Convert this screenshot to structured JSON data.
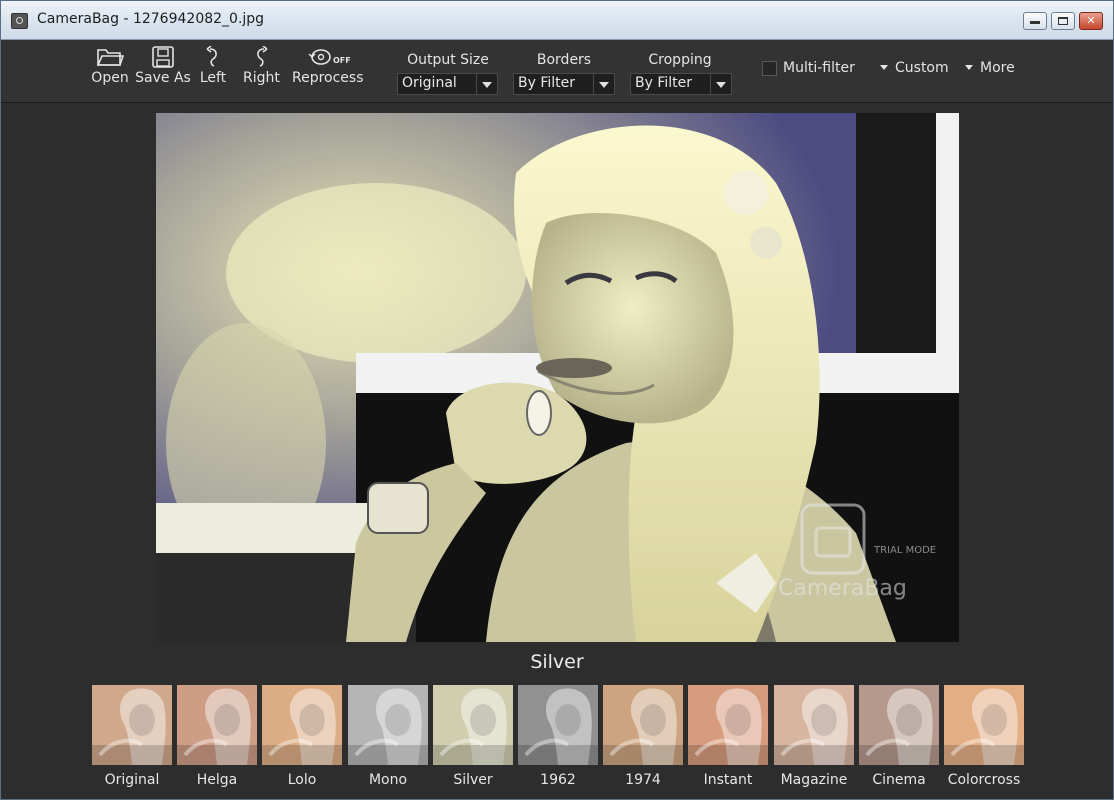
{
  "window": {
    "title": "CameraBag - 1276942082_0.jpg"
  },
  "toolbar": {
    "buttons": [
      {
        "label": "Open",
        "icon": "folder-icon"
      },
      {
        "label": "Save As",
        "icon": "save-icon"
      },
      {
        "label": "Left",
        "icon": "rotate-left-icon"
      },
      {
        "label": "Right",
        "icon": "rotate-right-icon"
      },
      {
        "label": "Reprocess",
        "icon": "reprocess-icon",
        "toggle": "OFF"
      }
    ],
    "output_size": {
      "label": "Output Size",
      "value": "Original"
    },
    "borders": {
      "label": "Borders",
      "value": "By Filter"
    },
    "cropping": {
      "label": "Cropping",
      "value": "By Filter"
    },
    "multi_filter": {
      "label": "Multi-filter",
      "checked": false
    },
    "custom": "Custom",
    "more": "More"
  },
  "preview": {
    "filter_name": "Silver",
    "watermark": "CameraBag",
    "watermark_sub": "TRIAL MODE"
  },
  "filters": [
    {
      "label": "Original",
      "tint": "#c89b78"
    },
    {
      "label": "Helga",
      "tint": "#c58c70"
    },
    {
      "label": "Lolo",
      "tint": "#d8a070"
    },
    {
      "label": "Mono",
      "tint": "#a8a8a8"
    },
    {
      "label": "Silver",
      "tint": "#c8c6a0"
    },
    {
      "label": "1962",
      "tint": "#7e7e7e"
    },
    {
      "label": "1974",
      "tint": "#c4956a"
    },
    {
      "label": "Instant",
      "tint": "#d08a68"
    },
    {
      "label": "Magazine",
      "tint": "#d0a890"
    },
    {
      "label": "Cinema",
      "tint": "#a8887a"
    },
    {
      "label": "Colorcross",
      "tint": "#e0a070"
    }
  ],
  "colors": {
    "background": "#2d2d2d",
    "toolbar": "#333333",
    "text": "#e4e4e4"
  }
}
